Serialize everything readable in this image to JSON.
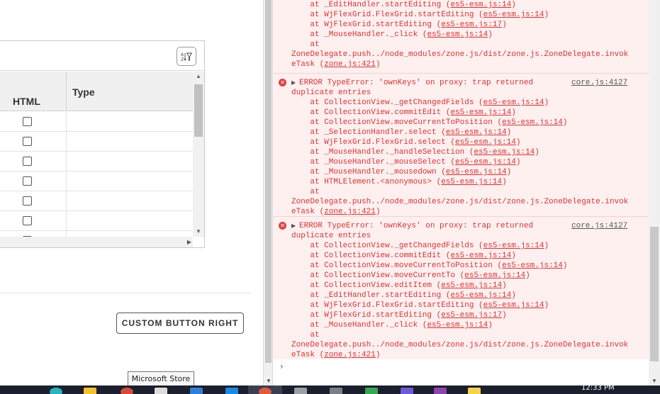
{
  "app": {
    "grid": {
      "columns": [
        "HTML",
        "Type"
      ],
      "row_count": 7
    },
    "custom_button_label": "CUSTOM BUTTON RIGHT"
  },
  "console": {
    "message0": {
      "lines": [
        "    at _EditHandler.startEditing (",
        "    at WjFlexGrid.FlexGrid.startEditing (",
        "    at WjFlexGrid.startEditing (",
        "    at _MouseHandler._click (",
        "    at",
        "ZoneDelegate.push../node_modules/zone.js/dist/zone.js.ZoneDelegate.invok",
        "eTask ("
      ],
      "links": [
        "es5-esm.js:14",
        "es5-esm.js:14",
        "es5-esm.js:17",
        "es5-esm.js:14",
        "zone.js:421"
      ]
    },
    "message1": {
      "source": "core.js:4127",
      "header": "ERROR TypeError: 'ownKeys' on proxy: trap returned",
      "header2": "duplicate entries",
      "lines": [
        "    at CollectionView._getChangedFields (",
        "    at CollectionView.commitEdit (",
        "    at CollectionView.moveCurrentToPosition (",
        "    at _SelectionHandler.select (",
        "    at WjFlexGrid.FlexGrid.select (",
        "    at _MouseHandler._handleSelection (",
        "    at _MouseHandler._mouseSelect (",
        "    at _MouseHandler._mousedown (",
        "    at HTMLElement.<anonymous> (",
        "    at",
        "ZoneDelegate.push../node_modules/zone.js/dist/zone.js.ZoneDelegate.invok",
        "eTask ("
      ],
      "links": [
        "es5-esm.js:14",
        "es5-esm.js:14",
        "es5-esm.js:14",
        "es5-esm.js:14",
        "es5-esm.js:14",
        "es5-esm.js:14",
        "es5-esm.js:14",
        "es5-esm.js:14",
        "es5-esm.js:14",
        "zone.js:421"
      ]
    },
    "message2": {
      "source": "core.js:4127",
      "header": "ERROR TypeError: 'ownKeys' on proxy: trap returned",
      "header2": "duplicate entries",
      "lines": [
        "    at CollectionView._getChangedFields (",
        "    at CollectionView.commitEdit (",
        "    at CollectionView.moveCurrentToPosition (",
        "    at CollectionView.moveCurrentTo (",
        "    at CollectionView.editItem (",
        "    at _EditHandler.startEditing (",
        "    at WjFlexGrid.FlexGrid.startEditing (",
        "    at WjFlexGrid.startEditing (",
        "    at _MouseHandler._click (",
        "    at",
        "ZoneDelegate.push../node_modules/zone.js/dist/zone.js.ZoneDelegate.invok",
        "eTask ("
      ],
      "links": [
        "es5-esm.js:14",
        "es5-esm.js:14",
        "es5-esm.js:14",
        "es5-esm.js:14",
        "es5-esm.js:14",
        "es5-esm.js:14",
        "es5-esm.js:14",
        "es5-esm.js:17",
        "es5-esm.js:14",
        "zone.js:421"
      ]
    },
    "prompt_symbol": "›"
  },
  "tooltip": "Microsoft Store",
  "taskbar": {
    "clock": "12:33 PM"
  },
  "colors": {
    "error_text": "#e03030",
    "error_bg": "#fff0f0",
    "prompt": "#2a6ad3",
    "taskbar": "#1b1f2e"
  }
}
